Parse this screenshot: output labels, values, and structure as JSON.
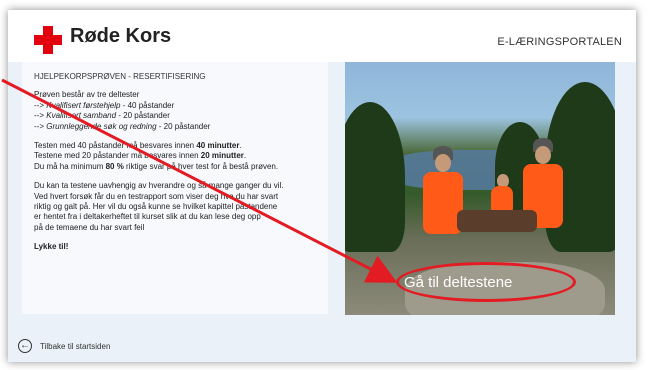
{
  "header": {
    "brand": "Røde Kors",
    "portal": "E-LÆRINGSPORTALEN"
  },
  "panel": {
    "title": "HJELPEKORPSPRØVEN - RESERTIFISERING",
    "intro": "Prøven består av tre deltester",
    "items": [
      {
        "prefix": "--> ",
        "name": "Kvalifisert førstehjelp",
        "suffix": " - 40 påstander"
      },
      {
        "prefix": "--> ",
        "name": "Kvalifisert samband",
        "suffix": " - 20 påstander"
      },
      {
        "prefix": "--> ",
        "name": "Grunnleggende søk og redning",
        "suffix": " - 20 påstander"
      }
    ],
    "time1_pre": "Testen med 40 påstander må besvares innen ",
    "time1_bold": "40 minutter",
    "time1_post": ".",
    "time2_pre": "Testene med 20 påstander må besvares innen ",
    "time2_bold": "20 minutter",
    "time2_post": ".",
    "min_pre": "Du må ha minimum ",
    "min_bold": "80 %",
    "min_post": " riktige svar på hver test for å bestå prøven.",
    "para_lines": [
      "Du kan ta testene uavhengig av hverandre og så mange ganger du vil.",
      "Ved hvert forsøk får du en testrapport som viser deg hva du har svart",
      "riktig og galt på. Her vil du også kunne se hvilket kapittel påstandene",
      "er hentet fra i deltakerheftet til kurset slik at du kan lese deg opp",
      "på de temaene du har svart feil"
    ],
    "closing": "Lykke til!"
  },
  "cta": {
    "label": "Gå til deltestene"
  },
  "footer": {
    "back_label": "Tilbake til startsiden"
  },
  "colors": {
    "brand_red": "#e3000f",
    "highlight_red": "#e31b23",
    "background": "#eaf1f8"
  }
}
